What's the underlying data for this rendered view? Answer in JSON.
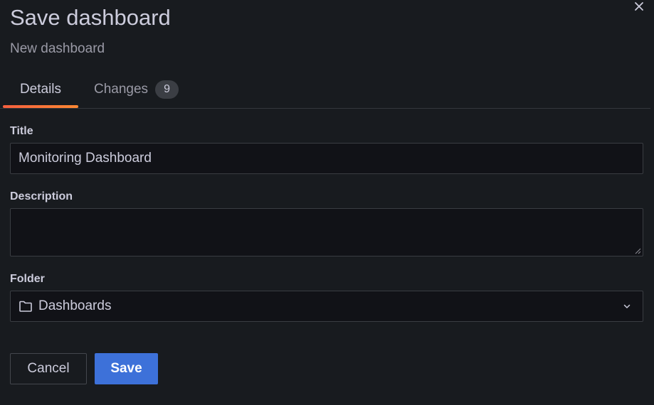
{
  "drawer": {
    "title": "Save dashboard",
    "subtitle": "New dashboard",
    "close_icon": "close-icon"
  },
  "tabs": [
    {
      "label": "Details",
      "active": true
    },
    {
      "label": "Changes",
      "count": "9",
      "active": false
    }
  ],
  "form": {
    "title_label": "Title",
    "title_value": "Monitoring Dashboard",
    "description_label": "Description",
    "description_value": "",
    "folder_label": "Folder",
    "folder_value": "Dashboards",
    "folder_icon": "folder-icon",
    "chevron_icon": "chevron-down-icon"
  },
  "actions": {
    "cancel_label": "Cancel",
    "save_label": "Save"
  },
  "colors": {
    "background": "#181b1f",
    "input_background": "#111217",
    "primary": "#3d71d9",
    "tab_underline": "#f55f3e"
  }
}
